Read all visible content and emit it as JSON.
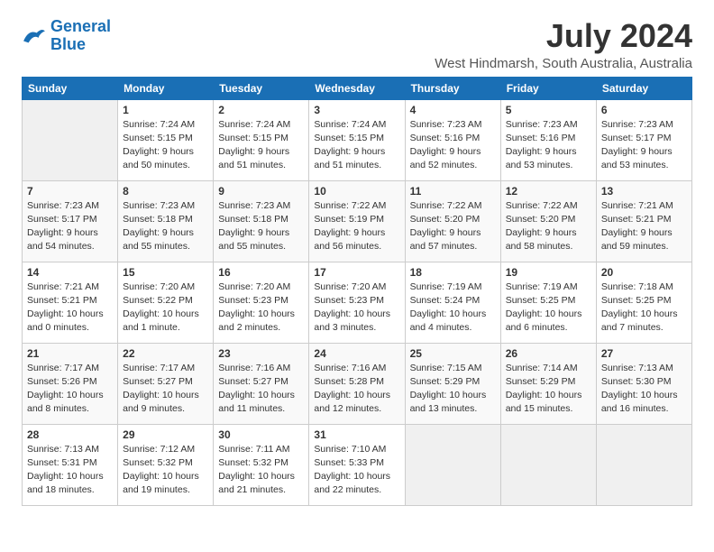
{
  "logo": {
    "line1": "General",
    "line2": "Blue"
  },
  "title": "July 2024",
  "subtitle": "West Hindmarsh, South Australia, Australia",
  "days_header": [
    "Sunday",
    "Monday",
    "Tuesday",
    "Wednesday",
    "Thursday",
    "Friday",
    "Saturday"
  ],
  "weeks": [
    [
      {
        "day": "",
        "sunrise": "",
        "sunset": "",
        "daylight": ""
      },
      {
        "day": "1",
        "sunrise": "Sunrise: 7:24 AM",
        "sunset": "Sunset: 5:15 PM",
        "daylight": "Daylight: 9 hours and 50 minutes."
      },
      {
        "day": "2",
        "sunrise": "Sunrise: 7:24 AM",
        "sunset": "Sunset: 5:15 PM",
        "daylight": "Daylight: 9 hours and 51 minutes."
      },
      {
        "day": "3",
        "sunrise": "Sunrise: 7:24 AM",
        "sunset": "Sunset: 5:15 PM",
        "daylight": "Daylight: 9 hours and 51 minutes."
      },
      {
        "day": "4",
        "sunrise": "Sunrise: 7:23 AM",
        "sunset": "Sunset: 5:16 PM",
        "daylight": "Daylight: 9 hours and 52 minutes."
      },
      {
        "day": "5",
        "sunrise": "Sunrise: 7:23 AM",
        "sunset": "Sunset: 5:16 PM",
        "daylight": "Daylight: 9 hours and 53 minutes."
      },
      {
        "day": "6",
        "sunrise": "Sunrise: 7:23 AM",
        "sunset": "Sunset: 5:17 PM",
        "daylight": "Daylight: 9 hours and 53 minutes."
      }
    ],
    [
      {
        "day": "7",
        "sunrise": "Sunrise: 7:23 AM",
        "sunset": "Sunset: 5:17 PM",
        "daylight": "Daylight: 9 hours and 54 minutes."
      },
      {
        "day": "8",
        "sunrise": "Sunrise: 7:23 AM",
        "sunset": "Sunset: 5:18 PM",
        "daylight": "Daylight: 9 hours and 55 minutes."
      },
      {
        "day": "9",
        "sunrise": "Sunrise: 7:23 AM",
        "sunset": "Sunset: 5:18 PM",
        "daylight": "Daylight: 9 hours and 55 minutes."
      },
      {
        "day": "10",
        "sunrise": "Sunrise: 7:22 AM",
        "sunset": "Sunset: 5:19 PM",
        "daylight": "Daylight: 9 hours and 56 minutes."
      },
      {
        "day": "11",
        "sunrise": "Sunrise: 7:22 AM",
        "sunset": "Sunset: 5:20 PM",
        "daylight": "Daylight: 9 hours and 57 minutes."
      },
      {
        "day": "12",
        "sunrise": "Sunrise: 7:22 AM",
        "sunset": "Sunset: 5:20 PM",
        "daylight": "Daylight: 9 hours and 58 minutes."
      },
      {
        "day": "13",
        "sunrise": "Sunrise: 7:21 AM",
        "sunset": "Sunset: 5:21 PM",
        "daylight": "Daylight: 9 hours and 59 minutes."
      }
    ],
    [
      {
        "day": "14",
        "sunrise": "Sunrise: 7:21 AM",
        "sunset": "Sunset: 5:21 PM",
        "daylight": "Daylight: 10 hours and 0 minutes."
      },
      {
        "day": "15",
        "sunrise": "Sunrise: 7:20 AM",
        "sunset": "Sunset: 5:22 PM",
        "daylight": "Daylight: 10 hours and 1 minute."
      },
      {
        "day": "16",
        "sunrise": "Sunrise: 7:20 AM",
        "sunset": "Sunset: 5:23 PM",
        "daylight": "Daylight: 10 hours and 2 minutes."
      },
      {
        "day": "17",
        "sunrise": "Sunrise: 7:20 AM",
        "sunset": "Sunset: 5:23 PM",
        "daylight": "Daylight: 10 hours and 3 minutes."
      },
      {
        "day": "18",
        "sunrise": "Sunrise: 7:19 AM",
        "sunset": "Sunset: 5:24 PM",
        "daylight": "Daylight: 10 hours and 4 minutes."
      },
      {
        "day": "19",
        "sunrise": "Sunrise: 7:19 AM",
        "sunset": "Sunset: 5:25 PM",
        "daylight": "Daylight: 10 hours and 6 minutes."
      },
      {
        "day": "20",
        "sunrise": "Sunrise: 7:18 AM",
        "sunset": "Sunset: 5:25 PM",
        "daylight": "Daylight: 10 hours and 7 minutes."
      }
    ],
    [
      {
        "day": "21",
        "sunrise": "Sunrise: 7:17 AM",
        "sunset": "Sunset: 5:26 PM",
        "daylight": "Daylight: 10 hours and 8 minutes."
      },
      {
        "day": "22",
        "sunrise": "Sunrise: 7:17 AM",
        "sunset": "Sunset: 5:27 PM",
        "daylight": "Daylight: 10 hours and 9 minutes."
      },
      {
        "day": "23",
        "sunrise": "Sunrise: 7:16 AM",
        "sunset": "Sunset: 5:27 PM",
        "daylight": "Daylight: 10 hours and 11 minutes."
      },
      {
        "day": "24",
        "sunrise": "Sunrise: 7:16 AM",
        "sunset": "Sunset: 5:28 PM",
        "daylight": "Daylight: 10 hours and 12 minutes."
      },
      {
        "day": "25",
        "sunrise": "Sunrise: 7:15 AM",
        "sunset": "Sunset: 5:29 PM",
        "daylight": "Daylight: 10 hours and 13 minutes."
      },
      {
        "day": "26",
        "sunrise": "Sunrise: 7:14 AM",
        "sunset": "Sunset: 5:29 PM",
        "daylight": "Daylight: 10 hours and 15 minutes."
      },
      {
        "day": "27",
        "sunrise": "Sunrise: 7:13 AM",
        "sunset": "Sunset: 5:30 PM",
        "daylight": "Daylight: 10 hours and 16 minutes."
      }
    ],
    [
      {
        "day": "28",
        "sunrise": "Sunrise: 7:13 AM",
        "sunset": "Sunset: 5:31 PM",
        "daylight": "Daylight: 10 hours and 18 minutes."
      },
      {
        "day": "29",
        "sunrise": "Sunrise: 7:12 AM",
        "sunset": "Sunset: 5:32 PM",
        "daylight": "Daylight: 10 hours and 19 minutes."
      },
      {
        "day": "30",
        "sunrise": "Sunrise: 7:11 AM",
        "sunset": "Sunset: 5:32 PM",
        "daylight": "Daylight: 10 hours and 21 minutes."
      },
      {
        "day": "31",
        "sunrise": "Sunrise: 7:10 AM",
        "sunset": "Sunset: 5:33 PM",
        "daylight": "Daylight: 10 hours and 22 minutes."
      },
      {
        "day": "",
        "sunrise": "",
        "sunset": "",
        "daylight": ""
      },
      {
        "day": "",
        "sunrise": "",
        "sunset": "",
        "daylight": ""
      },
      {
        "day": "",
        "sunrise": "",
        "sunset": "",
        "daylight": ""
      }
    ]
  ]
}
